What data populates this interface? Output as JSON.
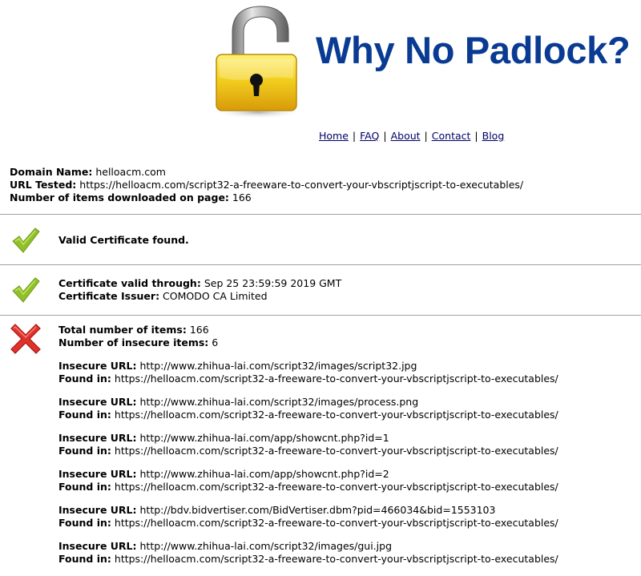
{
  "header": {
    "title": "Why No Padlock?"
  },
  "nav": {
    "home": "Home",
    "faq": "FAQ",
    "about": "About",
    "contact": "Contact",
    "blog": "Blog",
    "separator": "|"
  },
  "meta": {
    "domain_label": "Domain Name:",
    "domain_value": "helloacm.com",
    "url_label": "URL Tested:",
    "url_value": "https://helloacm.com/script32-a-freeware-to-convert-your-vbscriptjscript-to-executables/",
    "items_label": "Number of items downloaded on page:",
    "items_value": "166"
  },
  "cert_found": {
    "status_icon": "check-icon",
    "text": "Valid Certificate found."
  },
  "cert_details": {
    "status_icon": "check-icon",
    "valid_label": "Certificate valid through:",
    "valid_value": "Sep 25 23:59:59 2019 GMT",
    "issuer_label": "Certificate Issuer:",
    "issuer_value": "COMODO CA Limited"
  },
  "insecure": {
    "status_icon": "cross-icon",
    "total_label": "Total number of items:",
    "total_value": "166",
    "insecure_label": "Number of insecure items:",
    "insecure_value": "6",
    "url_label": "Insecure URL:",
    "found_label": "Found in:",
    "items": [
      {
        "url": "http://www.zhihua-lai.com/script32/images/script32.jpg",
        "found": "https://helloacm.com/script32-a-freeware-to-convert-your-vbscriptjscript-to-executables/"
      },
      {
        "url": "http://www.zhihua-lai.com/script32/images/process.png",
        "found": "https://helloacm.com/script32-a-freeware-to-convert-your-vbscriptjscript-to-executables/"
      },
      {
        "url": "http://www.zhihua-lai.com/app/showcnt.php?id=1",
        "found": "https://helloacm.com/script32-a-freeware-to-convert-your-vbscriptjscript-to-executables/"
      },
      {
        "url": "http://www.zhihua-lai.com/app/showcnt.php?id=2",
        "found": "https://helloacm.com/script32-a-freeware-to-convert-your-vbscriptjscript-to-executables/"
      },
      {
        "url": "http://bdv.bidvertiser.com/BidVertiser.dbm?pid=466034&bid=1553103",
        "found": "https://helloacm.com/script32-a-freeware-to-convert-your-vbscriptjscript-to-executables/"
      },
      {
        "url": "http://www.zhihua-lai.com/script32/images/gui.jpg",
        "found": "https://helloacm.com/script32-a-freeware-to-convert-your-vbscriptjscript-to-executables/"
      }
    ]
  }
}
